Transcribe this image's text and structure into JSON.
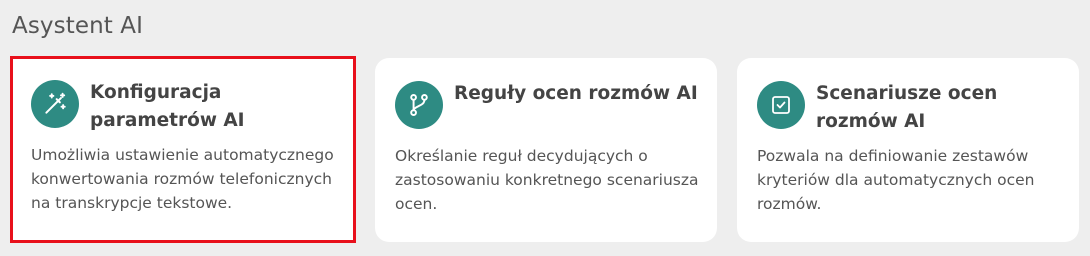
{
  "section": {
    "title": "Asystent AI"
  },
  "cards": [
    {
      "title": "Konfiguracja parametrów AI",
      "description": "Umożliwia ustawienie automatycznego konwertowania rozmów telefonicznych na transkrypcje tekstowe.",
      "icon": "magic-wand-icon",
      "selected": true
    },
    {
      "title": "Reguły ocen rozmów AI",
      "description": "Określanie reguł decydujących o zastosowaniu konkretnego scenariusza ocen.",
      "icon": "branch-icon",
      "selected": false
    },
    {
      "title": "Scenariusze ocen rozmów AI",
      "description": "Pozwala na definiowanie zestawów kryteriów dla automatycznych ocen rozmów.",
      "icon": "checkbox-icon",
      "selected": false
    }
  ],
  "colors": {
    "accent": "#2e8b83",
    "selection_border": "#e8101b",
    "background": "#eeeeee",
    "card": "#ffffff"
  }
}
